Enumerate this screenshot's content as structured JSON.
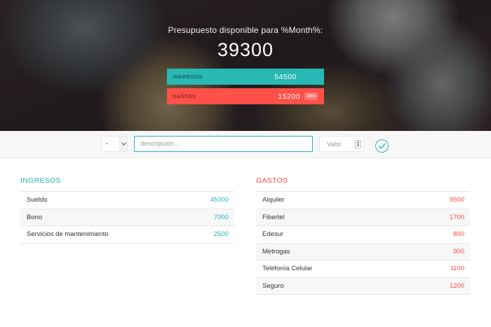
{
  "header": {
    "title": "Presupuesto disponible para %Month%:",
    "available": "39300",
    "income": {
      "label": "Ingresos",
      "value": "54500"
    },
    "expenses": {
      "label": "Gastos",
      "value": "15200",
      "percentage": "28%"
    }
  },
  "add_bar": {
    "type_value": "-",
    "description_placeholder": "descripcion...",
    "value_placeholder": "Valor"
  },
  "income_list": {
    "title": "Ingresos",
    "items": [
      {
        "name": "Sueldo",
        "value": "45000"
      },
      {
        "name": "Bono",
        "value": "7000"
      },
      {
        "name": "Servicios de mantenimiento",
        "value": "2500"
      }
    ]
  },
  "expense_list": {
    "title": "Gastos",
    "items": [
      {
        "name": "Alquiler",
        "value": "9500"
      },
      {
        "name": "Fibertel",
        "value": "1700"
      },
      {
        "name": "Edesur",
        "value": "800"
      },
      {
        "name": "Metrogas",
        "value": "900"
      },
      {
        "name": "Telefonía Celular",
        "value": "1100"
      },
      {
        "name": "Seguro",
        "value": "1200"
      }
    ]
  },
  "colors": {
    "accent_income": "#28b9b5",
    "accent_expense": "#ff5049"
  }
}
